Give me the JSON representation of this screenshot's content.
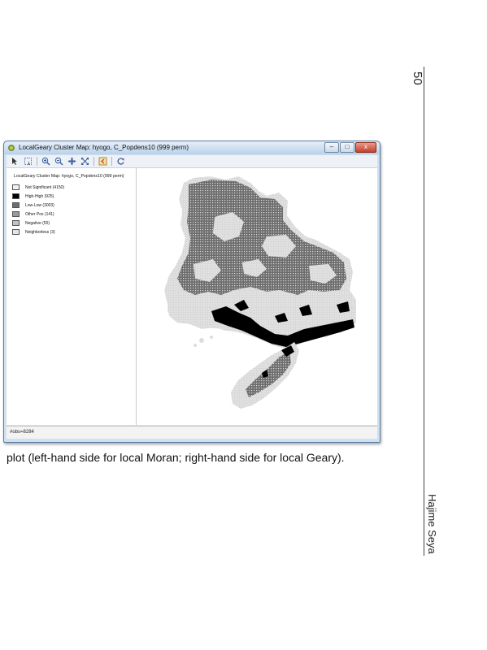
{
  "page": {
    "page_number": "50",
    "author": "Hajime Seya",
    "caption": "plot (left-hand side for local Moran; right-hand side for local Geary)."
  },
  "window": {
    "title": "LocalGeary Cluster Map: hyogo, C_Popdens10 (999 perm)",
    "buttons": {
      "minimize": "–",
      "maximize": "□",
      "close": "x"
    },
    "toolbar_icons": [
      "select-arrow-icon",
      "select-rect-icon",
      "zoom-in-icon",
      "zoom-out-icon",
      "pan-icon",
      "full-extent-icon",
      "back-icon",
      "refresh-icon"
    ],
    "status": "#obs=8284"
  },
  "legend": {
    "title": "LocalGeary Cluster Map: hyogo, C_Popdens10 (999 perm)",
    "items": [
      {
        "label": "Not Significant (4150)",
        "color": "#f2f2f2"
      },
      {
        "label": "High-High (925)",
        "color": "#000000"
      },
      {
        "label": "Low-Low (3003)",
        "color": "#6e6e6e"
      },
      {
        "label": "Other Pos (141)",
        "color": "#9a9a9a"
      },
      {
        "label": "Negative (55)",
        "color": "#c2c2c2"
      },
      {
        "label": "Neighborless (3)",
        "color": "#e6e6e6"
      }
    ]
  },
  "map": {
    "colors": {
      "dark": "#6e6e6e",
      "light": "#d9d9d9",
      "black": "#000000",
      "white": "#ffffff"
    }
  }
}
